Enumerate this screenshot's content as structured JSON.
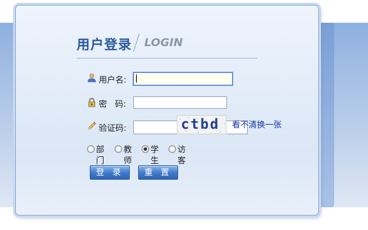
{
  "title": {
    "cn": "用户登录",
    "en": "LOGIN"
  },
  "form": {
    "username_label": "用户名:",
    "password_label": "密   码:",
    "captcha_label": "验证码:",
    "username_value": "",
    "password_value": "",
    "captcha_value": "",
    "captcha_image_text": "ctbd",
    "refresh_link": "看不清换一张"
  },
  "roles": [
    {
      "label": "部门",
      "checked": false
    },
    {
      "label": "教师",
      "checked": false
    },
    {
      "label": "学生",
      "checked": true
    },
    {
      "label": "访客",
      "checked": false
    }
  ],
  "buttons": {
    "login": "登 录",
    "reset": "重 置"
  },
  "colors": {
    "title": "#2b5a9a",
    "button": "#3f79c9",
    "link": "#1a34a0"
  },
  "icons": {
    "user": "user-icon",
    "lock": "lock-icon",
    "pencil": "pencil-icon"
  }
}
